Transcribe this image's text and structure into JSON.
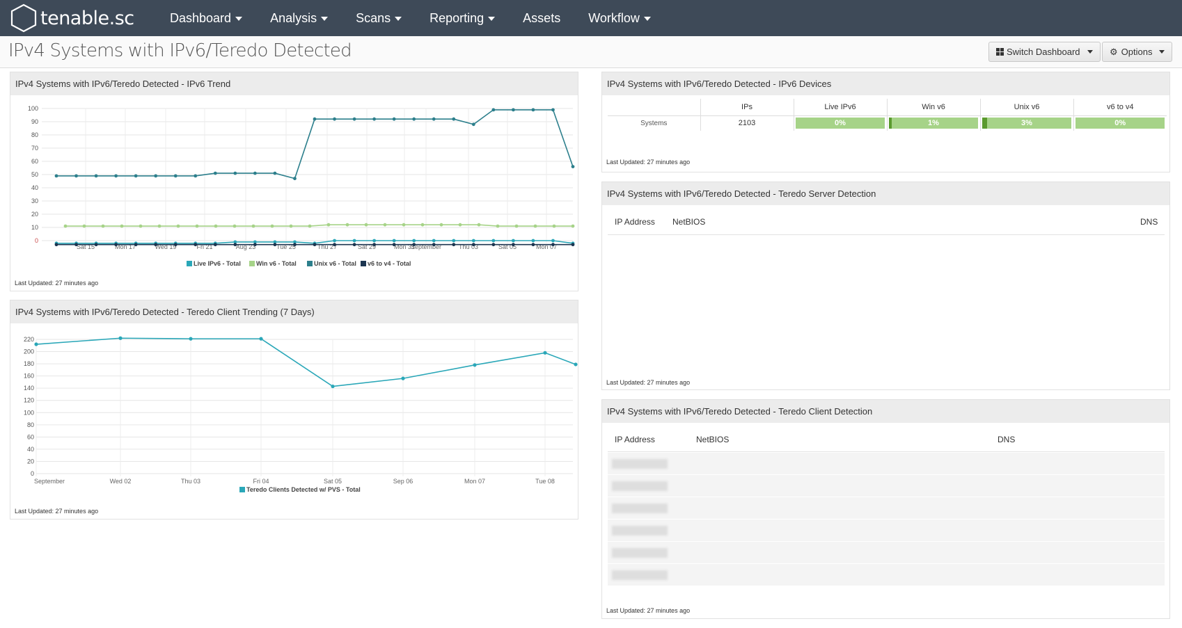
{
  "nav": {
    "logo_text": "tenable.sc",
    "items": [
      {
        "label": "Dashboard",
        "dropdown": true
      },
      {
        "label": "Analysis",
        "dropdown": true
      },
      {
        "label": "Scans",
        "dropdown": true
      },
      {
        "label": "Reporting",
        "dropdown": true
      },
      {
        "label": "Assets",
        "dropdown": false
      },
      {
        "label": "Workflow",
        "dropdown": true
      }
    ]
  },
  "page": {
    "title": "IPv4 Systems with IPv6/Teredo Detected",
    "switch_dashboard": "Switch Dashboard",
    "options": "Options"
  },
  "last_updated": "Last Updated: 27 minutes ago",
  "colors": {
    "live_ipv6": "#2aa7b8",
    "win_v6": "#a6d388",
    "unix_v6": "#2c7f8c",
    "v6_to_v4": "#1c3550",
    "bar_light": "#a6d388",
    "bar_dark": "#5a9a2e",
    "nav_bg": "#3e4a58"
  },
  "panels": {
    "ipv6_trend": {
      "title": "IPv4 Systems with IPv6/Teredo Detected - IPv6 Trend"
    },
    "teredo_client_trend": {
      "title": "IPv4 Systems with IPv6/Teredo Detected - Teredo Client Trending (7 Days)"
    },
    "ipv6_devices": {
      "title": "IPv4 Systems with IPv6/Teredo Detected - IPv6 Devices",
      "columns": [
        "",
        "IPs",
        "Live IPv6",
        "Win v6",
        "Unix v6",
        "v6 to v4"
      ],
      "row_label": "Systems",
      "ips": "2103",
      "bars": [
        {
          "label": "0%",
          "value": 0
        },
        {
          "label": "1%",
          "value": 1
        },
        {
          "label": "3%",
          "value": 3
        },
        {
          "label": "0%",
          "value": 0
        }
      ]
    },
    "teredo_server": {
      "title": "IPv4 Systems with IPv6/Teredo Detected - Teredo Server Detection",
      "columns": [
        "IP Address",
        "NetBIOS",
        "DNS"
      ]
    },
    "teredo_client": {
      "title": "IPv4 Systems with IPv6/Teredo Detected - Teredo Client Detection",
      "columns": [
        "IP Address",
        "NetBIOS",
        "DNS"
      ],
      "row_count": 6
    }
  },
  "chart_data": [
    {
      "type": "line",
      "title": "",
      "x_tick_labels": [
        "Sat 15",
        "Mon 17",
        "Wed 19",
        "Fri 21",
        "Aug 23",
        "Tue 25",
        "Thu 27",
        "Sat 29",
        "Mon 31",
        "September",
        "Thu 03",
        "Sat 05",
        "Mon 07"
      ],
      "ylim": [
        0,
        100
      ],
      "y_ticks": [
        0,
        10,
        20,
        30,
        40,
        50,
        60,
        70,
        80,
        90,
        100
      ],
      "grid": true,
      "legend": "bottom",
      "series": [
        {
          "name": "Live IPv6 - Total",
          "values": [
            -2,
            -2,
            -2,
            -2,
            -2,
            -2,
            -2,
            -2,
            -2,
            -1,
            -1,
            -1,
            -1,
            -2,
            0,
            0,
            0,
            0,
            0,
            0,
            0,
            0,
            0,
            0,
            0,
            0,
            -2
          ]
        },
        {
          "name": "Win v6 - Total",
          "values": [
            11,
            11,
            11,
            11,
            11,
            11,
            11,
            11,
            11,
            11,
            11,
            11,
            11,
            11,
            12,
            12,
            12,
            12,
            12,
            12,
            12,
            12,
            12,
            11,
            11,
            11,
            11,
            11
          ]
        },
        {
          "name": "Unix v6 - Total",
          "values": [
            49,
            49,
            49,
            49,
            49,
            49,
            49,
            49,
            51,
            51,
            51,
            51,
            47,
            92,
            92,
            92,
            92,
            92,
            92,
            92,
            92,
            88,
            99,
            99,
            99,
            99,
            56
          ]
        },
        {
          "name": "v6 to v4 - Total",
          "values": [
            -3,
            -3,
            -3,
            -3,
            -3,
            -3,
            -3,
            -3,
            -3,
            -3,
            -3,
            -3,
            -3,
            -3,
            -3,
            -3,
            -3,
            -3,
            -3,
            -3,
            -3,
            -3,
            -3,
            -3,
            -3,
            -3,
            -3
          ]
        }
      ]
    },
    {
      "type": "line",
      "title": "",
      "categories": [
        "September",
        "Wed 02",
        "Thu 03",
        "Fri 04",
        "Sat 05",
        "Sep 06",
        "Mon 07",
        "Tue 08"
      ],
      "ylim": [
        0,
        220
      ],
      "y_ticks": [
        0,
        20,
        40,
        60,
        80,
        100,
        120,
        140,
        160,
        180,
        200,
        220
      ],
      "grid": true,
      "legend": "bottom",
      "series": [
        {
          "name": "Teredo Clients Detected w/ PVS - Total",
          "x": [
            0,
            1,
            2,
            3,
            4,
            5,
            6,
            7,
            7.5
          ],
          "values": [
            212,
            222,
            221,
            221,
            143,
            156,
            178,
            198,
            179
          ]
        }
      ]
    }
  ]
}
